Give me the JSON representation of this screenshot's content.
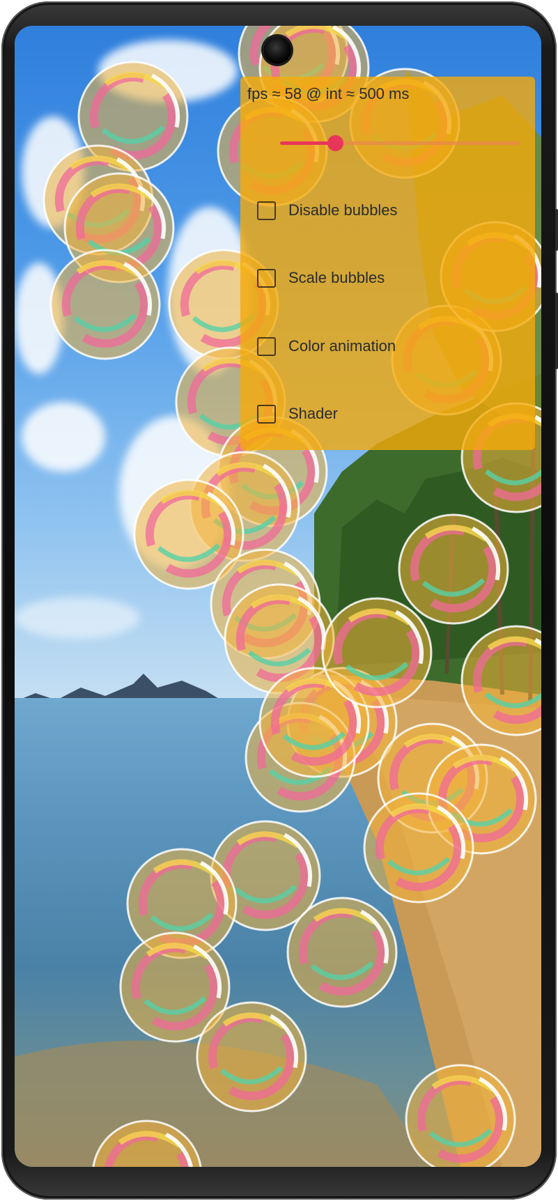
{
  "overlay": {
    "fps_text": "fps ≈ 58 @ int ≈ 500 ms",
    "interval_slider": {
      "value_fraction": 0.23,
      "track_color": "#e98a4a",
      "accent_color": "#e8365a"
    },
    "panel_color": "#f5aa0a",
    "options": [
      {
        "label": "Disable bubbles",
        "checked": false
      },
      {
        "label": "Scale bubbles",
        "checked": false
      },
      {
        "label": "Color animation",
        "checked": false
      },
      {
        "label": "Shader",
        "checked": false
      }
    ]
  },
  "background": {
    "scene": "tropical-beach-wallpaper",
    "sky_color": "#4f9be8",
    "sand_color": "#c89a52"
  },
  "bubbles": {
    "count": 38,
    "fill_color": "#f3b33a",
    "ring_colors": [
      "#f06a9a",
      "#56d1a6",
      "#f5d84a"
    ]
  }
}
